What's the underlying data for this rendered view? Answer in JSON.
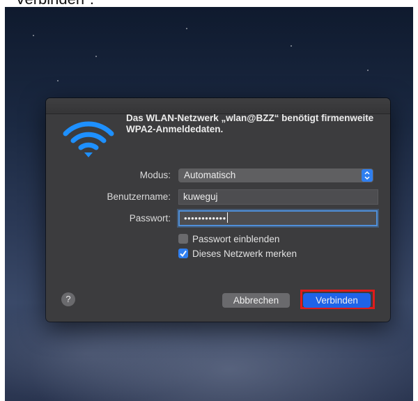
{
  "caption": "Verbinden\".",
  "dialog": {
    "message": "Das WLAN-Netzwerk „wlan@BZZ“ benötigt firmenweite WPA2-Anmeldedaten.",
    "icon": "wifi-icon",
    "modus": {
      "label": "Modus:",
      "value": "Automatisch"
    },
    "username": {
      "label": "Benutzername:",
      "value": "kuweguj"
    },
    "password": {
      "label": "Passwort:",
      "masked_value": "••••••••••••"
    },
    "options": [
      {
        "label": "Passwort einblenden",
        "checked": false
      },
      {
        "label": "Dieses Netzwerk merken",
        "checked": true
      }
    ],
    "help_label": "?",
    "cancel_label": "Abbrechen",
    "connect_label": "Verbinden"
  },
  "colors": {
    "accent": "#2f7ff0",
    "highlight_box": "#e01b1b",
    "dialog_bg": "#3c3c3e"
  }
}
